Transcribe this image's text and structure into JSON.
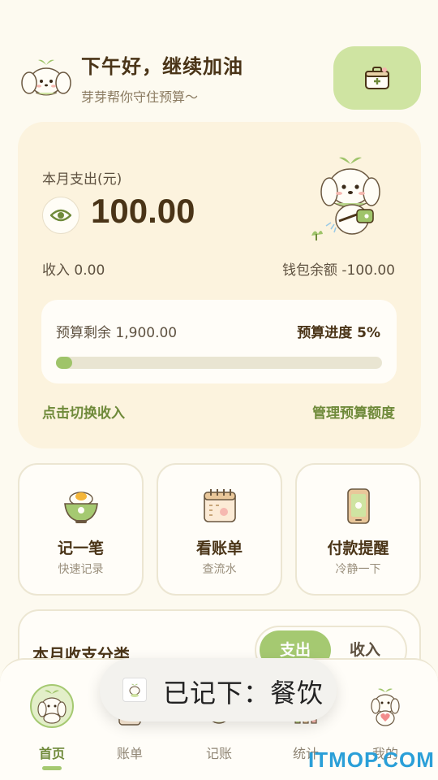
{
  "header": {
    "greeting": "下午好，继续加油",
    "subtitle": "芽芽帮你守住预算～"
  },
  "summary": {
    "title": "本月支出(元)",
    "amount": "100.00",
    "income_label": "收入 0.00",
    "balance_label": "钱包余额 -100.00",
    "budget_remaining": "预算剩余 1,900.00",
    "budget_progress_label": "预算进度 5%",
    "budget_progress": 0.05,
    "switch_income": "点击切换收入",
    "manage_budget": "管理预算额度"
  },
  "actions": [
    {
      "label": "记一笔",
      "sub": "快速记录",
      "icon": "rice-bowl-icon"
    },
    {
      "label": "看账单",
      "sub": "查流水",
      "icon": "calendar-icon"
    },
    {
      "label": "付款提醒",
      "sub": "冷静一下",
      "icon": "phone-icon"
    }
  ],
  "category": {
    "title": "本月收支分类",
    "tab_expense": "支出",
    "tab_income": "收入"
  },
  "tabbar": [
    {
      "label": "首页",
      "icon": "home-mascot-icon",
      "active": true
    },
    {
      "label": "账单",
      "icon": "bill-icon",
      "active": false
    },
    {
      "label": "记账",
      "icon": "add-record-icon",
      "active": false
    },
    {
      "label": "统计",
      "icon": "stats-icon",
      "active": false
    },
    {
      "label": "我的",
      "icon": "profile-mascot-icon",
      "active": false
    }
  ],
  "toast": {
    "text": "已记下：餐饮"
  },
  "watermark": "ITMOP.COM",
  "colors": {
    "background": "#fdfaf0",
    "accent_green": "#a5c971",
    "link_green": "#6f8a3a",
    "card": "#fcf3de",
    "text_dark": "#4a3417"
  }
}
